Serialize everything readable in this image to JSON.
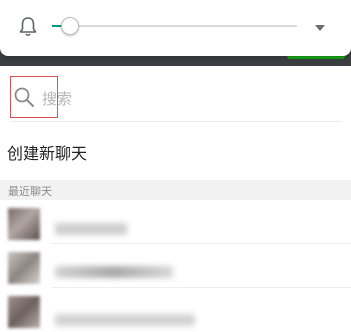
{
  "volume": {
    "level": 0.05
  },
  "search": {
    "placeholder": "搜索"
  },
  "actions": {
    "create_chat": "创建新聊天"
  },
  "recent": {
    "header": "最近聊天",
    "items": [
      {
        "name": ""
      },
      {
        "name": ""
      },
      {
        "name": ""
      }
    ]
  },
  "colors": {
    "accent": "#009688",
    "highlight_box": "#d9534f",
    "brand_green": "#1aad19"
  }
}
